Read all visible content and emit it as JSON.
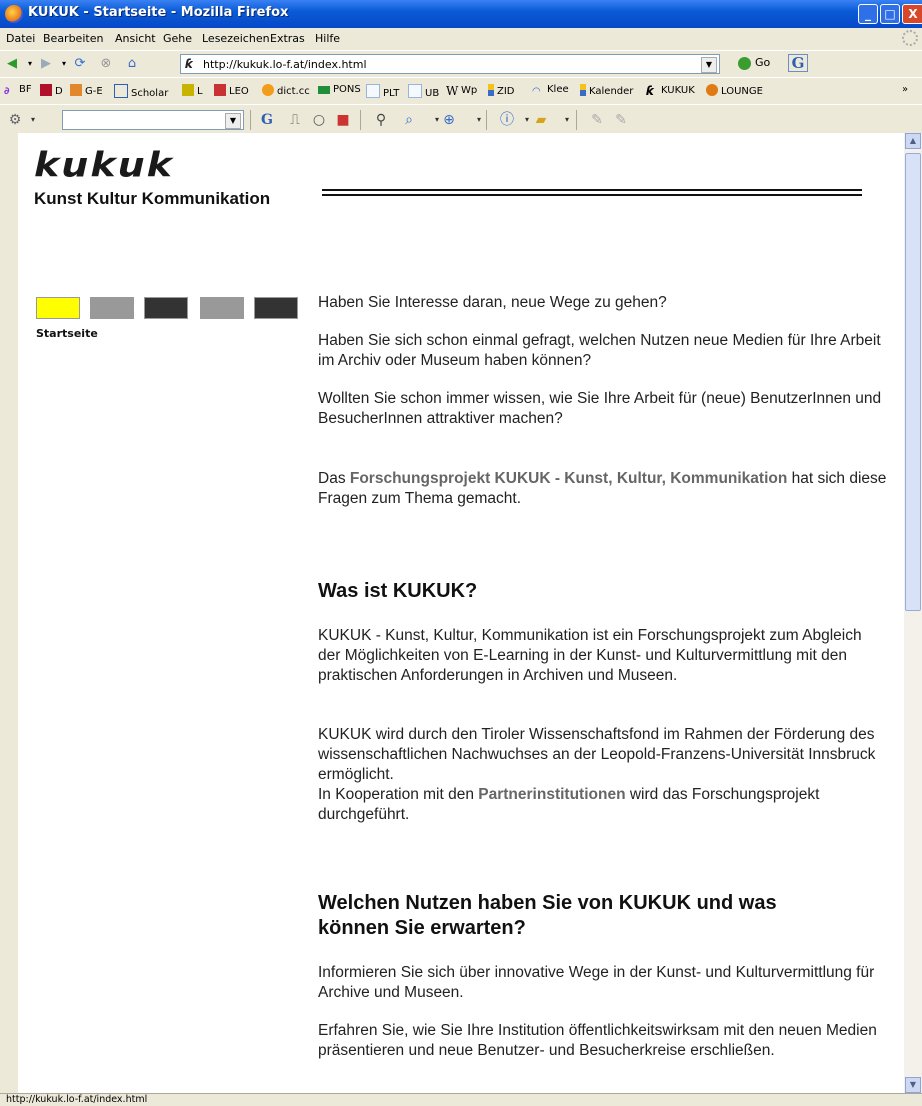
{
  "window": {
    "title": "KUKUK - Startseite - Mozilla Firefox",
    "min": "_",
    "max": "□",
    "close": "X"
  },
  "menu": [
    "Datei",
    "Bearbeiten",
    "Ansicht",
    "Gehe",
    "Lesezeichen",
    "Extras",
    "Hilfe"
  ],
  "nav": {
    "url": "http://kukuk.lo-f.at/index.html",
    "go_label": "Go",
    "g_icon": "G"
  },
  "bookmarks": [
    {
      "label": "BF",
      "icon": "bf-icon",
      "color": "#8a2be2"
    },
    {
      "label": "D",
      "icon": "d-icon",
      "color": "#b0102a"
    },
    {
      "label": "G-E",
      "icon": "de-icon",
      "color": "#e0882b"
    },
    {
      "label": "Scholar",
      "icon": "google-icon",
      "color": "#2f5fb3"
    },
    {
      "label": "L",
      "icon": "book-icon",
      "color": "#c8b400"
    },
    {
      "label": "LEO",
      "icon": "flag-icon",
      "color": "#c83232"
    },
    {
      "label": "dict.cc",
      "icon": "dict-icon",
      "color": "#f39c1a"
    },
    {
      "label": "PONS",
      "icon": "pons-icon",
      "color": "#1f8f3a"
    },
    {
      "label": "PLT",
      "icon": "page-icon",
      "color": "#9bb4d8"
    },
    {
      "label": "UB",
      "icon": "page-icon",
      "color": "#9bb4d8"
    },
    {
      "label": "Wp",
      "icon": "wikipedia-icon",
      "color": "#333333"
    },
    {
      "label": "ZID",
      "icon": "zid-icon",
      "color": "#3a6bc6"
    },
    {
      "label": "Klee",
      "icon": "klee-icon",
      "color": "#3a6bc6"
    },
    {
      "label": "Kalender",
      "icon": "calendar-icon",
      "color": "#3a6bc6"
    },
    {
      "label": "KUKUK",
      "icon": "kukuk-icon",
      "color": "#111111"
    },
    {
      "label": "LOUNGE",
      "icon": "lounge-icon",
      "color": "#e07a12"
    }
  ],
  "bookmarks_more": "»",
  "page": {
    "logo_word": "kukuk",
    "logo_tagline": "Kunst Kultur Kommunikation",
    "nav_boxes": [
      {
        "color": "#ffff00",
        "name": "nav-box-startseite"
      },
      {
        "color": "#999999",
        "name": "nav-box-2"
      },
      {
        "color": "#333333",
        "name": "nav-box-3"
      },
      {
        "color": "#999999",
        "name": "nav-box-4"
      },
      {
        "color": "#333333",
        "name": "nav-box-5"
      }
    ],
    "nav_label": "Startseite",
    "p1": "Haben Sie Interesse daran, neue Wege zu gehen?",
    "p2": "Haben Sie sich schon einmal gefragt, welchen Nutzen neue Medien für Ihre Arbeit im Archiv oder Museum haben können?",
    "p3": "Wollten Sie schon immer wissen, wie Sie Ihre Arbeit für (neue) BenutzerInnen und BesucherInnen attraktiver machen?",
    "p4_pre": "Das ",
    "p4_link": "Forschungsprojekt KUKUK - Kunst, Kultur, Kommunikation",
    "p4_post": " hat sich diese Fragen zum Thema gemacht.",
    "h1": "Was ist KUKUK?",
    "p5": "KUKUK - Kunst, Kultur, Kommunikation ist ein Forschungsprojekt zum Abgleich der Möglichkeiten von E-Learning in der Kunst- und Kulturvermittlung mit den praktischen Anforderungen in Archiven und Museen.",
    "p6": "KUKUK wird durch den Tiroler Wissenschaftsfond im Rahmen der Förderung des wissenschaftlichen Nachwuchses an der Leopold-Franzens-Universität Innsbruck ermöglicht.",
    "p7_pre": "In Kooperation mit den ",
    "p7_link": "Partnerinstitutionen",
    "p7_post": " wird das Forschungsprojekt durchgeführt.",
    "h2": "Welchen Nutzen haben Sie von KUKUK und was können Sie erwarten?",
    "p8": "Informieren Sie sich über innovative Wege in der Kunst- und Kulturvermittlung für Archive und Museen.",
    "p9": "Erfahren Sie, wie Sie Ihre Institution öffentlichkeitswirksam mit den neuen Medien präsentieren und neue Benutzer- und Besucherkreise erschließen."
  },
  "status": "http://kukuk.lo-f.at/index.html"
}
